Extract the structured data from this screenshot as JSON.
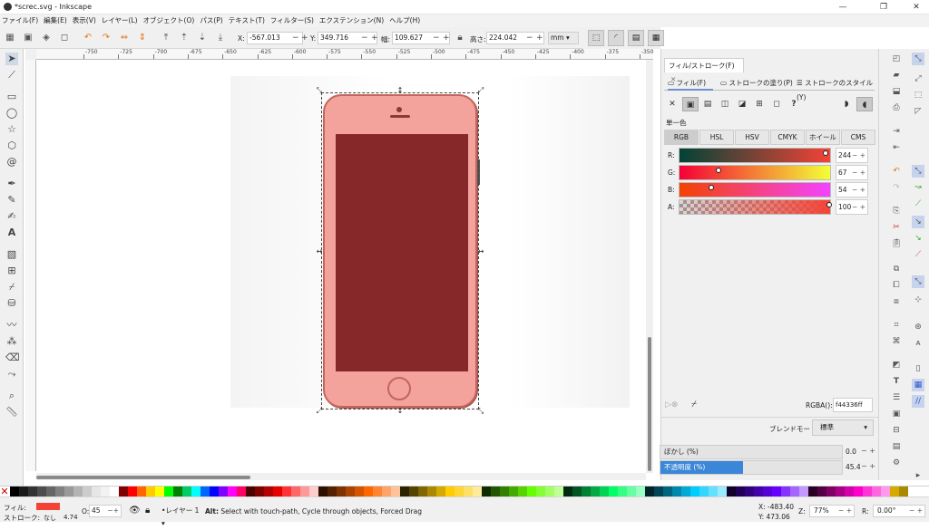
{
  "window": {
    "title": "*screc.svg - Inkscape",
    "min": "—",
    "max": "❐",
    "close": "✕"
  },
  "menu": [
    "ファイル(F)",
    "編集(E)",
    "表示(V)",
    "レイヤー(L)",
    "オブジェクト(O)",
    "パス(P)",
    "テキスト(T)",
    "フィルター(S)",
    "エクステンション(N)",
    "ヘルプ(H)"
  ],
  "controls": {
    "x_label": "X:",
    "x_value": "-567.013",
    "y_label": "Y:",
    "y_value": "349.716",
    "w_label": "幅:",
    "w_value": "109.627",
    "h_label": "高さ:",
    "h_value": "224.042",
    "unit": "mm"
  },
  "ruler_labels": [
    "-750",
    "-725",
    "-700",
    "-675",
    "-650",
    "-625",
    "-600",
    "-575",
    "-550",
    "-525",
    "-500",
    "-475",
    "-450",
    "-425",
    "-400",
    "-375",
    "-350"
  ],
  "dialog": {
    "tab_label": "フィル/ストローク(F)",
    "tab_close": "✕",
    "subtabs": [
      "フィル(F)",
      "ストロークの塗り(P)",
      "ストロークのスタイル(Y)"
    ],
    "paint_mode_label": "単一色",
    "color_modes": [
      "RGB",
      "HSL",
      "HSV",
      "CMYK",
      "ホイール",
      "CMS"
    ],
    "sliders": [
      {
        "label": "R:",
        "value": "244"
      },
      {
        "label": "G:",
        "value": "67"
      },
      {
        "label": "B:",
        "value": "54"
      },
      {
        "label": "A:",
        "value": "100"
      }
    ],
    "rgba_label": "RGBA():",
    "rgba_value": "f44336ff",
    "blend_label": "ブレンドモード:",
    "blend_value": "標準",
    "blur_label": "ぼかし (%)",
    "blur_value": "0.0",
    "opacity_label": "不透明度 (%)",
    "opacity_value": "45.4",
    "opacity_fill": 0.454
  },
  "status": {
    "fill_label": "フィル:",
    "stroke_label": "ストローク:",
    "stroke_value": "なし",
    "stroke_width": "4.74",
    "opacity_label": "O:",
    "opacity_value": "45",
    "layer": "•レイヤー 1",
    "message_bold": "Alt:",
    "message": "Select with touch-path, Cycle through objects, Forced Drag",
    "cx": "X: -483.40",
    "cy": "Y: 473.06",
    "zoom_label": "Z:",
    "zoom": "77%",
    "rot_label": "R:",
    "rotation": "0.00°"
  },
  "colors": {
    "fill": "#f44336",
    "accent": "#3a86d8"
  }
}
